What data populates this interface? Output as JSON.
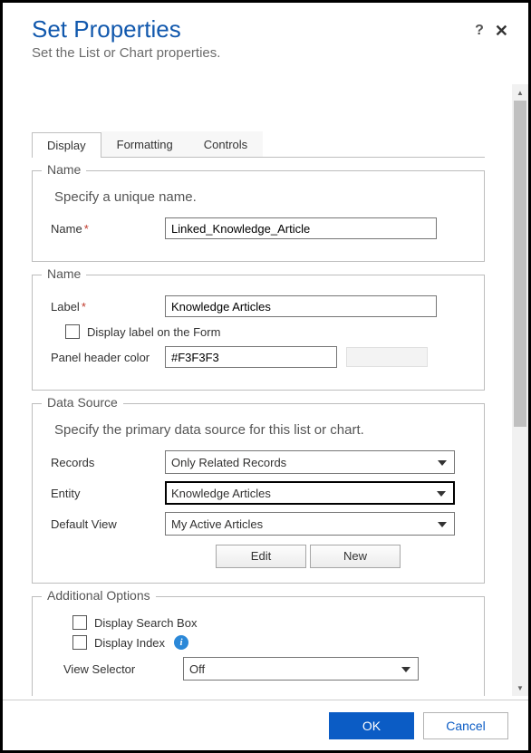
{
  "header": {
    "title": "Set Properties",
    "subtitle": "Set the List or Chart properties."
  },
  "tabs": {
    "display": "Display",
    "formatting": "Formatting",
    "controls": "Controls"
  },
  "group_name1": {
    "legend": "Name",
    "hint": "Specify a unique name.",
    "name_label": "Name",
    "name_value": "Linked_Knowledge_Article"
  },
  "group_name2": {
    "legend": "Name",
    "label_label": "Label",
    "label_value": "Knowledge Articles",
    "display_label_chk": "Display label on the Form",
    "panel_color_label": "Panel header color",
    "panel_color_value": "#F3F3F3"
  },
  "group_ds": {
    "legend": "Data Source",
    "hint": "Specify the primary data source for this list or chart.",
    "records_label": "Records",
    "records_value": "Only Related Records",
    "entity_label": "Entity",
    "entity_value": "Knowledge Articles",
    "view_label": "Default View",
    "view_value": "My Active Articles",
    "edit_btn": "Edit",
    "new_btn": "New"
  },
  "group_ao": {
    "legend": "Additional Options",
    "searchbox": "Display Search Box",
    "index": "Display Index",
    "viewsel_label": "View Selector",
    "viewsel_value": "Off"
  },
  "footer": {
    "ok": "OK",
    "cancel": "Cancel"
  }
}
